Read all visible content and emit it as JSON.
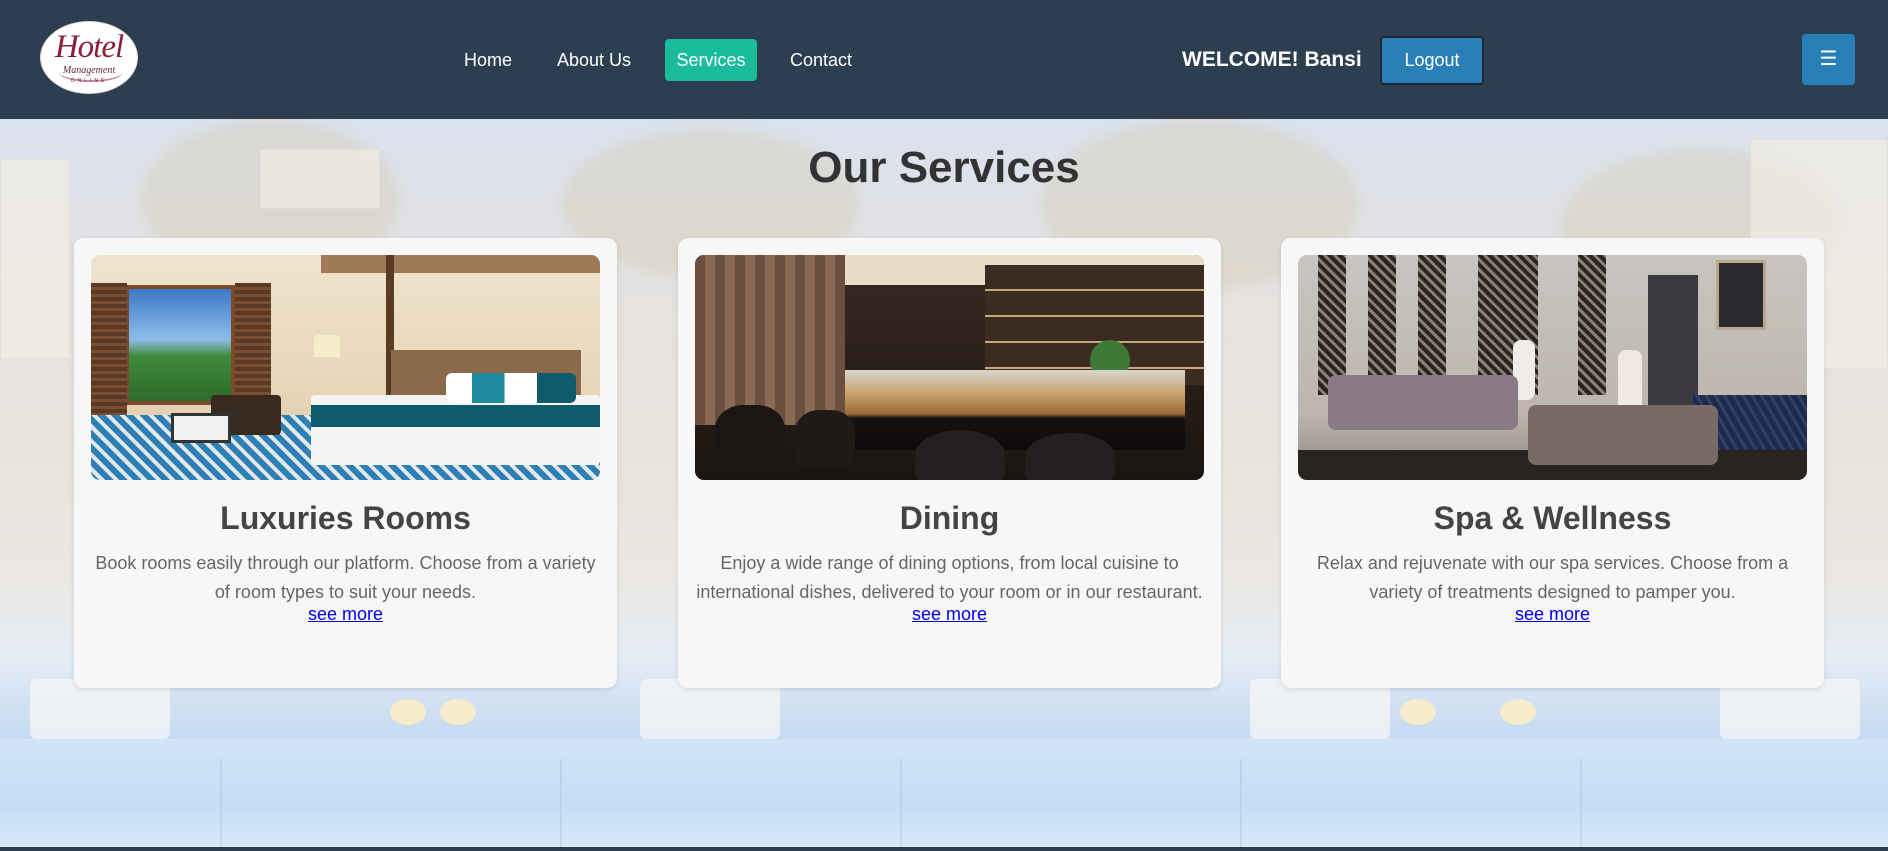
{
  "logo": {
    "script": "Hotel",
    "subtitle": "Management",
    "tagline": "ONLINE"
  },
  "nav": {
    "items": [
      {
        "label": "Home",
        "active": false
      },
      {
        "label": "About Us",
        "active": false
      },
      {
        "label": "Services",
        "active": true
      },
      {
        "label": "Contact",
        "active": false
      }
    ]
  },
  "user": {
    "welcome": "WELCOME! Bansi",
    "logout_label": "Logout"
  },
  "menu_icon": "☰",
  "page": {
    "title": "Our Services"
  },
  "services": [
    {
      "title": "Luxuries Rooms",
      "description": "Book rooms easily through our platform. Choose from a variety of room types to suit your needs.",
      "link_label": "see more",
      "image_icon": "hotel-room-photo"
    },
    {
      "title": "Dining",
      "description": "Enjoy a wide range of dining options, from local cuisine to international dishes, delivered to your room or in our restaurant.",
      "link_label": "see more",
      "image_icon": "restaurant-photo"
    },
    {
      "title": "Spa & Wellness",
      "description": "Relax and rejuvenate with our spa services. Choose from a variety of treatments designed to pamper you.",
      "link_label": "see more",
      "image_icon": "spa-photo"
    }
  ],
  "colors": {
    "header_bg": "#2c3e50",
    "active_nav": "#1abc9c",
    "logout_bg": "#2980b9",
    "menu_bg": "#2980b9",
    "link": "#0000ee",
    "card_bg": "#f7f7f7"
  }
}
